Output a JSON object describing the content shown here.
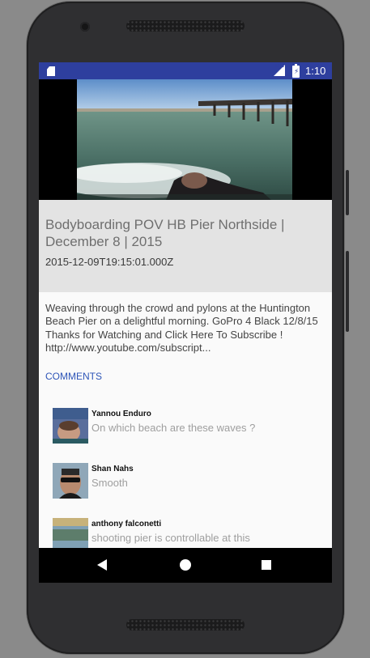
{
  "status_bar": {
    "time": "1:10",
    "network": "LTE",
    "icons": [
      "sd-card-icon",
      "lte-signal-icon",
      "battery-charging-icon"
    ]
  },
  "video": {
    "thumbnail": "surf-pier-video-frame"
  },
  "video_info": {
    "title": "Bodyboarding POV HB Pier Northside | December 8 | 2015",
    "published": "2015-12-09T19:15:01.000Z"
  },
  "description": "Weaving through the crowd and pylons at the Huntington Beach Pier on a delightful morning. GoPro 4 Black 12/8/15 Thanks for Watching and Click Here To Subscribe ! http://www.youtube.com/subscript...",
  "comments_section": {
    "header": "COMMENTS",
    "items": [
      {
        "author": "Yannou Enduro",
        "text": "On which beach are these  waves ?"
      },
      {
        "author": "Shan Nahs",
        "text": "Smooth"
      },
      {
        "author": "anthony falconetti",
        "text": "shooting pier is controllable at this"
      }
    ]
  },
  "nav_bar": {
    "icons": [
      "back-icon",
      "home-icon",
      "recents-icon"
    ]
  },
  "colors": {
    "status_bar": "#2e3f9e",
    "title_box": "#e3e3e3",
    "link_accent": "#2e55b8"
  }
}
